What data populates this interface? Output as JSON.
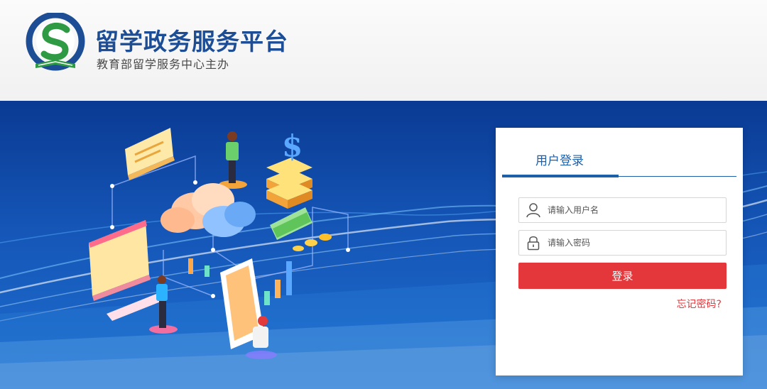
{
  "header": {
    "title": "留学政务服务平台",
    "subtitle": "教育部留学服务中心主办"
  },
  "login": {
    "tab_label": "用户登录",
    "username_placeholder": "请输入用户名",
    "password_placeholder": "请输入密码",
    "submit_label": "登录",
    "forgot_label": "忘记密码?"
  },
  "icons": {
    "logo": "cscse-logo-icon",
    "user": "user-icon",
    "lock": "lock-icon"
  },
  "colors": {
    "brand_blue": "#1d4e95",
    "tab_blue": "#1d5fa8",
    "login_red": "#e3373b",
    "logo_green": "#2f9a44",
    "banner_top": "#0a3a93",
    "banner_bottom": "#1e6fd0"
  }
}
